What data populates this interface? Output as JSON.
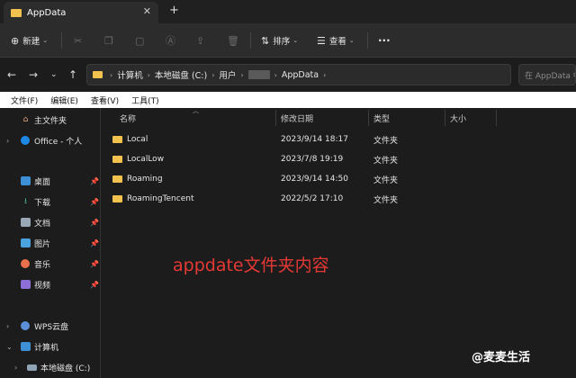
{
  "window": {
    "tab_title": "AppData",
    "tab_close": "✕",
    "new_tab": "+"
  },
  "toolbar": {
    "new_label": "新建",
    "sort_label": "排序",
    "view_label": "查看",
    "more_label": "···"
  },
  "address": {
    "crumbs": [
      "计算机",
      "本地磁盘 (C:)",
      "用户",
      "AppData"
    ],
    "search_placeholder": "在 AppData 中"
  },
  "menubar": [
    "文件(F)",
    "编辑(E)",
    "查看(V)",
    "工具(T)"
  ],
  "sidebar": {
    "items": [
      {
        "label": "主文件夹"
      },
      {
        "label": "Office - 个人"
      },
      {
        "label": "桌面"
      },
      {
        "label": "下载"
      },
      {
        "label": "文档"
      },
      {
        "label": "图片"
      },
      {
        "label": "音乐"
      },
      {
        "label": "视频"
      },
      {
        "label": "WPS云盘"
      },
      {
        "label": "计算机"
      },
      {
        "label": "本地磁盘 (C:)"
      }
    ]
  },
  "list": {
    "columns": [
      "名称",
      "修改日期",
      "类型",
      "大小"
    ],
    "rows": [
      {
        "name": "Local",
        "date": "2023/9/14 18:17",
        "type": "文件夹"
      },
      {
        "name": "LocalLow",
        "date": "2023/7/8 19:19",
        "type": "文件夹"
      },
      {
        "name": "Roaming",
        "date": "2023/9/14 14:50",
        "type": "文件夹"
      },
      {
        "name": "RoamingTencent",
        "date": "2022/5/2 17:10",
        "type": "文件夹"
      }
    ]
  },
  "annotation": "appdate文件夹内容",
  "watermark": "@麦麦生活"
}
